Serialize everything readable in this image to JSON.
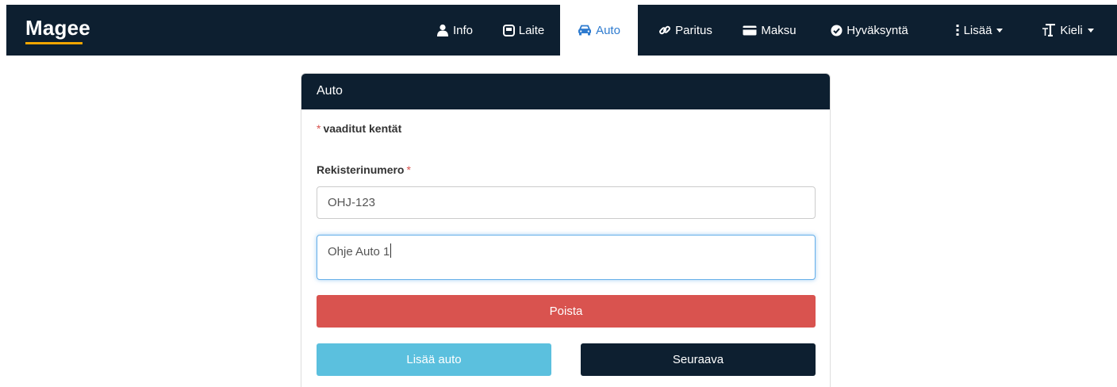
{
  "brand": {
    "name": "Magee"
  },
  "nav": {
    "items": [
      {
        "label": "Info",
        "icon": "user-icon"
      },
      {
        "label": "Laite",
        "icon": "device-icon"
      },
      {
        "label": "Auto",
        "icon": "car-icon",
        "active": true
      },
      {
        "label": "Paritus",
        "icon": "link-icon"
      },
      {
        "label": "Maksu",
        "icon": "credit-card-icon"
      },
      {
        "label": "Hyväksyntä",
        "icon": "check-circle-icon"
      },
      {
        "label": "Lisää",
        "icon": "vertical-ellipsis-icon"
      },
      {
        "label": "Kieli",
        "icon": "text-size-icon"
      }
    ]
  },
  "panel": {
    "title": "Auto",
    "required_star": "*",
    "required_note": "vaaditut kentät",
    "reg_label": "Rekisterinumero",
    "reg_value": "OHJ-123",
    "name_value": "Ohje Auto 1",
    "delete_label": "Poista",
    "add_label": "Lisää auto",
    "next_label": "Seuraava"
  },
  "colors": {
    "navbar": "#0d1f30",
    "active_link": "#2e7bcf",
    "danger": "#d9534f",
    "info": "#5bc0de",
    "brand_underline": "#f0a500"
  }
}
